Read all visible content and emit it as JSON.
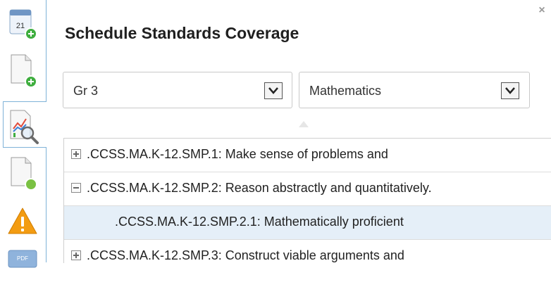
{
  "header": {
    "title": "Schedule Standards Coverage",
    "close_label": "×"
  },
  "filters": {
    "grade": {
      "value": "Gr 3"
    },
    "subject": {
      "value": "Mathematics"
    }
  },
  "rail": {
    "items": [
      {
        "icon": "calendar-add-icon",
        "calendar_day": "21"
      },
      {
        "icon": "document-add-icon"
      },
      {
        "icon": "chart-search-icon",
        "active": true
      },
      {
        "icon": "document-status-icon"
      },
      {
        "icon": "warning-icon"
      },
      {
        "icon": "pdf-export-icon",
        "badge": "PDF"
      }
    ]
  },
  "tree": {
    "rows": [
      {
        "label": ".CCSS.MA.K-12.SMP.1: Make sense of problems and",
        "toggle": "plus",
        "level": 0
      },
      {
        "label": ".CCSS.MA.K-12.SMP.2: Reason abstractly and quantitatively.",
        "toggle": "minus",
        "level": 0
      },
      {
        "label": ".CCSS.MA.K-12.SMP.2.1: Mathematically proficient",
        "toggle": "none",
        "level": 1,
        "selected": true
      },
      {
        "label": ".CCSS.MA.K-12.SMP.3: Construct viable arguments and",
        "toggle": "plus",
        "level": 0
      }
    ]
  },
  "colors": {
    "accent_border": "#7fb2d8",
    "selected_row": "#e5eff8",
    "warning": "#f39c12",
    "green": "#3fae3f"
  }
}
